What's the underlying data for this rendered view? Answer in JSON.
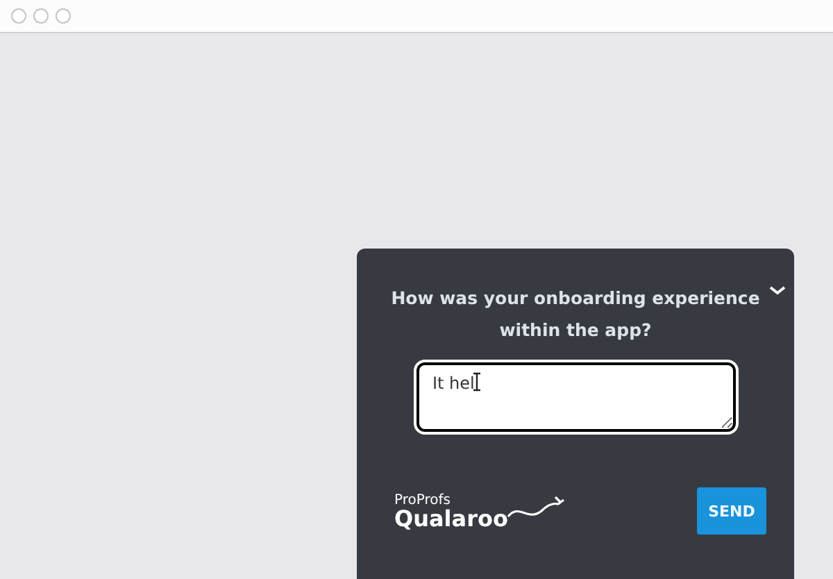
{
  "survey": {
    "question": "How was your onboarding experience within the app?",
    "answer": {
      "value": "It hel"
    },
    "logo": {
      "top": "ProProfs",
      "bottom": "Qualaroo"
    },
    "button": "SEND"
  }
}
